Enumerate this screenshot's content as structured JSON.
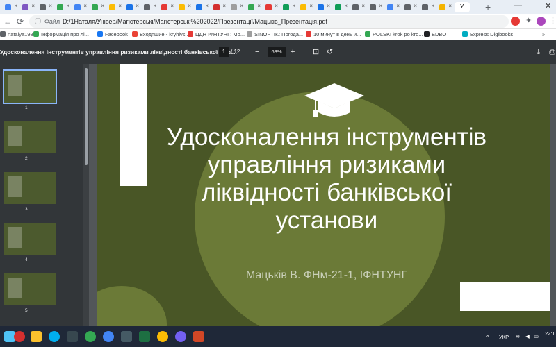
{
  "browser": {
    "tabs": [
      {
        "color": "#4285f4"
      },
      {
        "color": "#7e57c2"
      },
      {
        "color": "#5f6368"
      },
      {
        "color": "#34a853"
      },
      {
        "color": "#4285f4"
      },
      {
        "color": "#34a853"
      },
      {
        "color": "#fbbc04"
      },
      {
        "color": "#1a73e8"
      },
      {
        "color": "#5f6368"
      },
      {
        "color": "#e53935"
      },
      {
        "color": "#fbbc04"
      },
      {
        "color": "#1a73e8"
      },
      {
        "color": "#d32f2f"
      },
      {
        "color": "#9e9e9e"
      },
      {
        "color": "#34a853"
      },
      {
        "color": "#e53935"
      },
      {
        "color": "#0f9d58"
      },
      {
        "color": "#fbbc04"
      },
      {
        "color": "#1a73e8"
      },
      {
        "color": "#0f9d58"
      },
      {
        "color": "#5f6368"
      },
      {
        "color": "#5f6368"
      },
      {
        "color": "#4285f4"
      },
      {
        "color": "#5f6368"
      },
      {
        "color": "#5f6368"
      },
      {
        "color": "#f4b400"
      }
    ],
    "active_tab_label": "У",
    "omnibox": {
      "scheme": "Файл",
      "url": "D:/1Наталя/Універ/Магістерські/Магістерські%202022/Презентації/Мацьків_Презентація.pdf"
    },
    "bookmarks": [
      {
        "label": "natalya198...",
        "color": "#5f6368"
      },
      {
        "label": "Інформація про лі...",
        "color": "#34a853"
      },
      {
        "label": "Facebook",
        "color": "#1877f2"
      },
      {
        "label": "Входящие - kryhivs...",
        "color": "#ea4335"
      },
      {
        "label": "ЦДН ІФНТУНГ: Мо...",
        "color": "#e53935"
      },
      {
        "label": "SINOPTIK: Погода...",
        "color": "#9e9e9e"
      },
      {
        "label": "10 минут в день и...",
        "color": "#e53935"
      },
      {
        "label": "POLSKI krok po kro...",
        "color": "#34a853"
      },
      {
        "label": "EDBO",
        "color": "#202124"
      },
      {
        "label": "Express Digibooks",
        "color": "#00acc1"
      }
    ],
    "bookmarks_more": "»"
  },
  "pdf": {
    "title": "Удосконалення інструментів управління ризиками ліквідності банківської уста...",
    "page_current": "1",
    "page_total": "/ 12",
    "zoom": "63%",
    "thumbnails": [
      {
        "num": "1"
      },
      {
        "num": "2"
      },
      {
        "num": "3"
      },
      {
        "num": "4"
      },
      {
        "num": "5"
      }
    ],
    "slide": {
      "title_lines": [
        "Удосконалення інструментів",
        "управління ризиками",
        "ліквідності банківської",
        "установи"
      ],
      "subtitle": "Мацьків В. ФНм-21-1, ІФНТУНГ"
    },
    "colors": {
      "slide_bg": "#495626",
      "circle": "#6b7a37",
      "toolbar": "#323639"
    }
  },
  "taskbar": {
    "lang": "УКР",
    "time": "22:1"
  }
}
